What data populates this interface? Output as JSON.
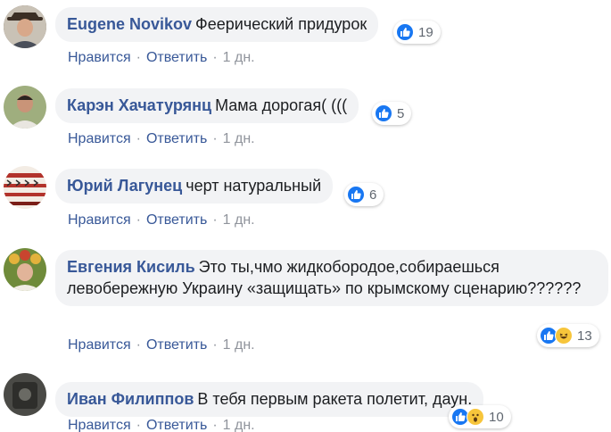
{
  "comments": [
    {
      "author": "Eugene Novikov",
      "text": "Феерический придурок",
      "reactions_count": "19",
      "reaction_types": [
        "like"
      ],
      "actions": {
        "like": "Нравится",
        "reply": "Ответить",
        "time": "1 дн."
      }
    },
    {
      "author": "Карэн Хачатурянц",
      "text": "Мама дорогая( (((",
      "reactions_count": "5",
      "reaction_types": [
        "like"
      ],
      "actions": {
        "like": "Нравится",
        "reply": "Ответить",
        "time": "1 дн."
      }
    },
    {
      "author": "Юрий Лагунец",
      "text": "черт натуральный",
      "reactions_count": "6",
      "reaction_types": [
        "like"
      ],
      "actions": {
        "like": "Нравится",
        "reply": "Ответить",
        "time": "1 дн."
      }
    },
    {
      "author": "Евгения Кисиль",
      "text": "Это ты,чмо жидкобородое,собираешься левобережную Украину «защищать» по крымскому сценарию??????",
      "reactions_count": "13",
      "reaction_types": [
        "like",
        "haha"
      ],
      "actions": {
        "like": "Нравится",
        "reply": "Ответить",
        "time": "1 дн."
      }
    },
    {
      "author": "Иван Филиппов",
      "text": "В тебя первым ракета полетит, даун.",
      "reactions_count": "10",
      "reaction_types": [
        "like",
        "wow"
      ],
      "actions": {
        "like": "Нравится",
        "reply": "Ответить",
        "time": "1 дн."
      }
    }
  ],
  "colors": {
    "author_link": "#385898",
    "bubble_bg": "#f2f3f5",
    "meta_gray": "#90949c",
    "like_blue": "#1877f2",
    "emoji_yellow": "#f7c53b"
  }
}
